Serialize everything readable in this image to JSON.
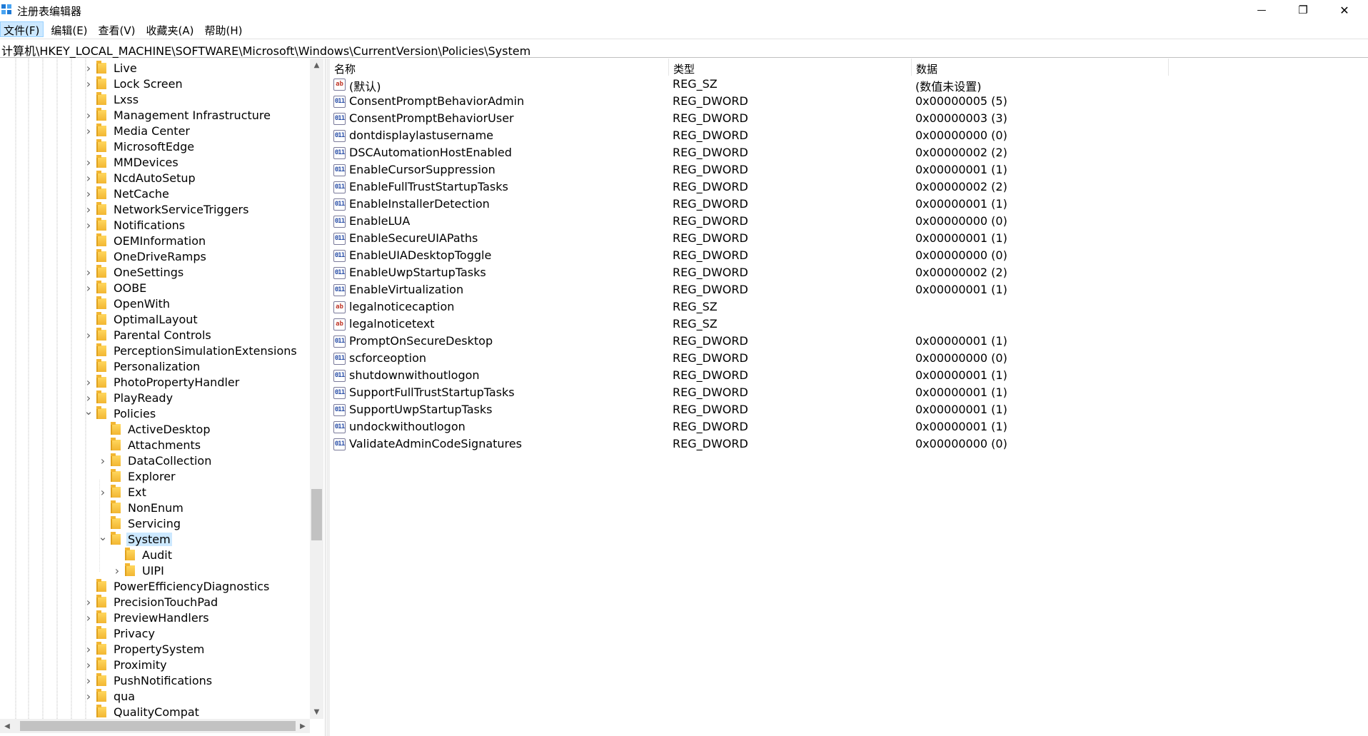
{
  "window": {
    "title": "注册表编辑器",
    "controls": {
      "minimize": "—",
      "maximize": "❐",
      "close": "✕"
    }
  },
  "menu": [
    "文件(F)",
    "编辑(E)",
    "查看(V)",
    "收藏夹(A)",
    "帮助(H)"
  ],
  "address": "计算机\\HKEY_LOCAL_MACHINE\\SOFTWARE\\Microsoft\\Windows\\CurrentVersion\\Policies\\System",
  "tree": [
    {
      "label": "Live",
      "depth": 0,
      "expander": "collapsed"
    },
    {
      "label": "Lock Screen",
      "depth": 0,
      "expander": "collapsed"
    },
    {
      "label": "Lxss",
      "depth": 0,
      "expander": "none"
    },
    {
      "label": "Management Infrastructure",
      "depth": 0,
      "expander": "collapsed"
    },
    {
      "label": "Media Center",
      "depth": 0,
      "expander": "collapsed"
    },
    {
      "label": "MicrosoftEdge",
      "depth": 0,
      "expander": "none"
    },
    {
      "label": "MMDevices",
      "depth": 0,
      "expander": "collapsed"
    },
    {
      "label": "NcdAutoSetup",
      "depth": 0,
      "expander": "collapsed"
    },
    {
      "label": "NetCache",
      "depth": 0,
      "expander": "collapsed"
    },
    {
      "label": "NetworkServiceTriggers",
      "depth": 0,
      "expander": "collapsed"
    },
    {
      "label": "Notifications",
      "depth": 0,
      "expander": "collapsed"
    },
    {
      "label": "OEMInformation",
      "depth": 0,
      "expander": "none"
    },
    {
      "label": "OneDriveRamps",
      "depth": 0,
      "expander": "none"
    },
    {
      "label": "OneSettings",
      "depth": 0,
      "expander": "collapsed"
    },
    {
      "label": "OOBE",
      "depth": 0,
      "expander": "collapsed"
    },
    {
      "label": "OpenWith",
      "depth": 0,
      "expander": "none"
    },
    {
      "label": "OptimalLayout",
      "depth": 0,
      "expander": "none"
    },
    {
      "label": "Parental Controls",
      "depth": 0,
      "expander": "collapsed"
    },
    {
      "label": "PerceptionSimulationExtensions",
      "depth": 0,
      "expander": "none"
    },
    {
      "label": "Personalization",
      "depth": 0,
      "expander": "none"
    },
    {
      "label": "PhotoPropertyHandler",
      "depth": 0,
      "expander": "collapsed"
    },
    {
      "label": "PlayReady",
      "depth": 0,
      "expander": "collapsed"
    },
    {
      "label": "Policies",
      "depth": 0,
      "expander": "expanded"
    },
    {
      "label": "ActiveDesktop",
      "depth": 1,
      "expander": "none"
    },
    {
      "label": "Attachments",
      "depth": 1,
      "expander": "none"
    },
    {
      "label": "DataCollection",
      "depth": 1,
      "expander": "collapsed"
    },
    {
      "label": "Explorer",
      "depth": 1,
      "expander": "none"
    },
    {
      "label": "Ext",
      "depth": 1,
      "expander": "collapsed"
    },
    {
      "label": "NonEnum",
      "depth": 1,
      "expander": "none"
    },
    {
      "label": "Servicing",
      "depth": 1,
      "expander": "none"
    },
    {
      "label": "System",
      "depth": 1,
      "expander": "expanded",
      "selected": true
    },
    {
      "label": "Audit",
      "depth": 2,
      "expander": "none"
    },
    {
      "label": "UIPI",
      "depth": 2,
      "expander": "collapsed"
    },
    {
      "label": "PowerEfficiencyDiagnostics",
      "depth": 0,
      "expander": "none"
    },
    {
      "label": "PrecisionTouchPad",
      "depth": 0,
      "expander": "collapsed"
    },
    {
      "label": "PreviewHandlers",
      "depth": 0,
      "expander": "collapsed"
    },
    {
      "label": "Privacy",
      "depth": 0,
      "expander": "none"
    },
    {
      "label": "PropertySystem",
      "depth": 0,
      "expander": "collapsed"
    },
    {
      "label": "Proximity",
      "depth": 0,
      "expander": "collapsed"
    },
    {
      "label": "PushNotifications",
      "depth": 0,
      "expander": "collapsed"
    },
    {
      "label": "qua",
      "depth": 0,
      "expander": "collapsed"
    },
    {
      "label": "QualityCompat",
      "depth": 0,
      "expander": "none"
    }
  ],
  "values_pane": {
    "headers": {
      "name": "名称",
      "type": "类型",
      "data": "数据"
    },
    "rows": [
      {
        "icon": "sz",
        "name": "(默认)",
        "type": "REG_SZ",
        "data": "(数值未设置)"
      },
      {
        "icon": "dword",
        "name": "ConsentPromptBehaviorAdmin",
        "type": "REG_DWORD",
        "data": "0x00000005 (5)"
      },
      {
        "icon": "dword",
        "name": "ConsentPromptBehaviorUser",
        "type": "REG_DWORD",
        "data": "0x00000003 (3)"
      },
      {
        "icon": "dword",
        "name": "dontdisplaylastusername",
        "type": "REG_DWORD",
        "data": "0x00000000 (0)"
      },
      {
        "icon": "dword",
        "name": "DSCAutomationHostEnabled",
        "type": "REG_DWORD",
        "data": "0x00000002 (2)"
      },
      {
        "icon": "dword",
        "name": "EnableCursorSuppression",
        "type": "REG_DWORD",
        "data": "0x00000001 (1)"
      },
      {
        "icon": "dword",
        "name": "EnableFullTrustStartupTasks",
        "type": "REG_DWORD",
        "data": "0x00000002 (2)"
      },
      {
        "icon": "dword",
        "name": "EnableInstallerDetection",
        "type": "REG_DWORD",
        "data": "0x00000001 (1)"
      },
      {
        "icon": "dword",
        "name": "EnableLUA",
        "type": "REG_DWORD",
        "data": "0x00000000 (0)"
      },
      {
        "icon": "dword",
        "name": "EnableSecureUIAPaths",
        "type": "REG_DWORD",
        "data": "0x00000001 (1)"
      },
      {
        "icon": "dword",
        "name": "EnableUIADesktopToggle",
        "type": "REG_DWORD",
        "data": "0x00000000 (0)"
      },
      {
        "icon": "dword",
        "name": "EnableUwpStartupTasks",
        "type": "REG_DWORD",
        "data": "0x00000002 (2)"
      },
      {
        "icon": "dword",
        "name": "EnableVirtualization",
        "type": "REG_DWORD",
        "data": "0x00000001 (1)"
      },
      {
        "icon": "sz",
        "name": "legalnoticecaption",
        "type": "REG_SZ",
        "data": ""
      },
      {
        "icon": "sz",
        "name": "legalnoticetext",
        "type": "REG_SZ",
        "data": ""
      },
      {
        "icon": "dword",
        "name": "PromptOnSecureDesktop",
        "type": "REG_DWORD",
        "data": "0x00000001 (1)"
      },
      {
        "icon": "dword",
        "name": "scforceoption",
        "type": "REG_DWORD",
        "data": "0x00000000 (0)"
      },
      {
        "icon": "dword",
        "name": "shutdownwithoutlogon",
        "type": "REG_DWORD",
        "data": "0x00000001 (1)"
      },
      {
        "icon": "dword",
        "name": "SupportFullTrustStartupTasks",
        "type": "REG_DWORD",
        "data": "0x00000001 (1)"
      },
      {
        "icon": "dword",
        "name": "SupportUwpStartupTasks",
        "type": "REG_DWORD",
        "data": "0x00000001 (1)"
      },
      {
        "icon": "dword",
        "name": "undockwithoutlogon",
        "type": "REG_DWORD",
        "data": "0x00000001 (1)"
      },
      {
        "icon": "dword",
        "name": "ValidateAdminCodeSignatures",
        "type": "REG_DWORD",
        "data": "0x00000000 (0)"
      }
    ]
  },
  "icons": {
    "sz": "ab",
    "dword": "011"
  },
  "colors": {
    "selection": "#cce8ff",
    "menu_highlight": "#cce8ff",
    "scroll_thumb": "#c2c2c2"
  }
}
